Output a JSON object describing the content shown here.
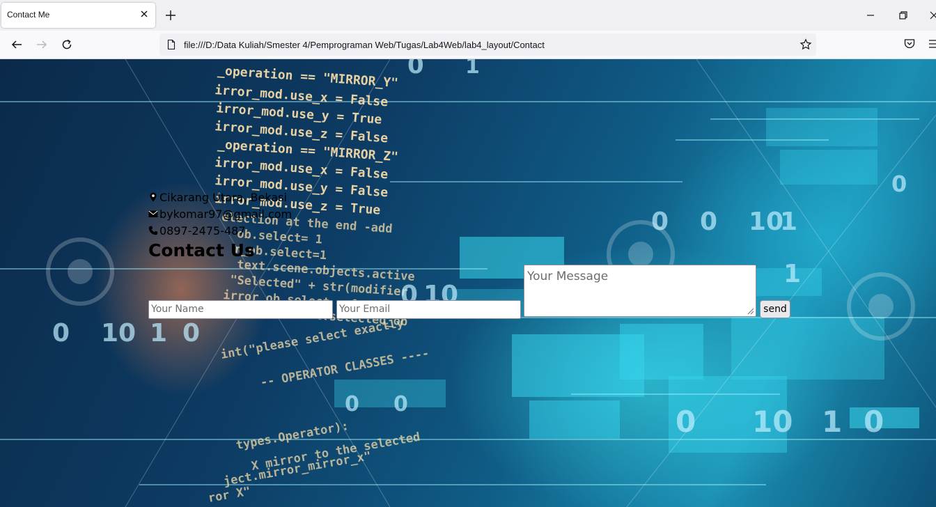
{
  "browser": {
    "tab_title": "Contact Me",
    "url": "file:///D:/Data Kuliah/Smester 4/Pemprograman Web/Tugas/Lab4Web/lab4_layout/Contact"
  },
  "contact": {
    "address": "Cikarang Utara, Bekasi",
    "email": "bykomar97@gmail.com",
    "phone": "0897-2475-487",
    "heading": "Contact Us"
  },
  "form": {
    "name_placeholder": "Your Name",
    "email_placeholder": "Your Email",
    "message_placeholder": "Your Message",
    "send_label": "send"
  },
  "background_code": [
    "_operation == \"MIRROR_Y\"",
    "irror_mod.use_x = False",
    "irror_mod.use_y = True",
    "irror_mod.use_z = False",
    "_operation == \"MIRROR_Z\"",
    "irror_mod.use_x = False",
    "irror_mod.use_y = False",
    "irror_mod.use_z = True",
    "election at the end -add",
    "ob.select= 1",
    "r_ob.select=1",
    "text.scene.objects.active",
    "\"Selected\" + str(modifier",
    "irror_ob.select = 0",
    "bpy.context.selected_ob",
    "int(\"please select exactly",
    "-- OPERATOR CLASSES ----",
    "types.Operator):",
    "X mirror to the selected",
    "ject.mirror_mirror_x\"",
    "ror X\""
  ],
  "background_digits": [
    "0",
    "1",
    "0",
    "0",
    "10",
    "1",
    "0",
    "0",
    "10",
    "1",
    "0",
    "0",
    "10",
    "1",
    "0",
    "0",
    "10",
    "1",
    "0",
    "0"
  ],
  "colors": {
    "code_text": "#f3d9a6",
    "digits": "#bfefff",
    "panel_cyan": "#38d8ef"
  }
}
